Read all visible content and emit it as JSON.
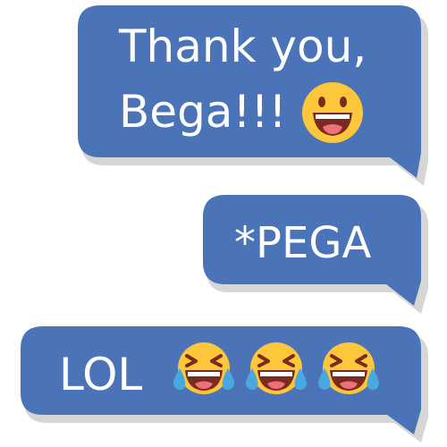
{
  "colors": {
    "bubble_fill": "#4a73b8",
    "bubble_shadow": "#d6d6d6",
    "text": "#ffffff",
    "emoji_face": "#fec63a",
    "emoji_mouth": "#7a2b1e",
    "emoji_tongue": "#f0707a",
    "emoji_tear": "#4aa8e0"
  },
  "messages": [
    {
      "lines": [
        "Thank you,",
        "Bega!!!"
      ],
      "emojis": [
        "grinning-face-emoji"
      ]
    },
    {
      "lines": [
        "*PEGA"
      ],
      "emojis": []
    },
    {
      "lines": [
        "LOL"
      ],
      "emojis": [
        "tears-of-joy-emoji",
        "tears-of-joy-emoji",
        "tears-of-joy-emoji"
      ]
    }
  ]
}
